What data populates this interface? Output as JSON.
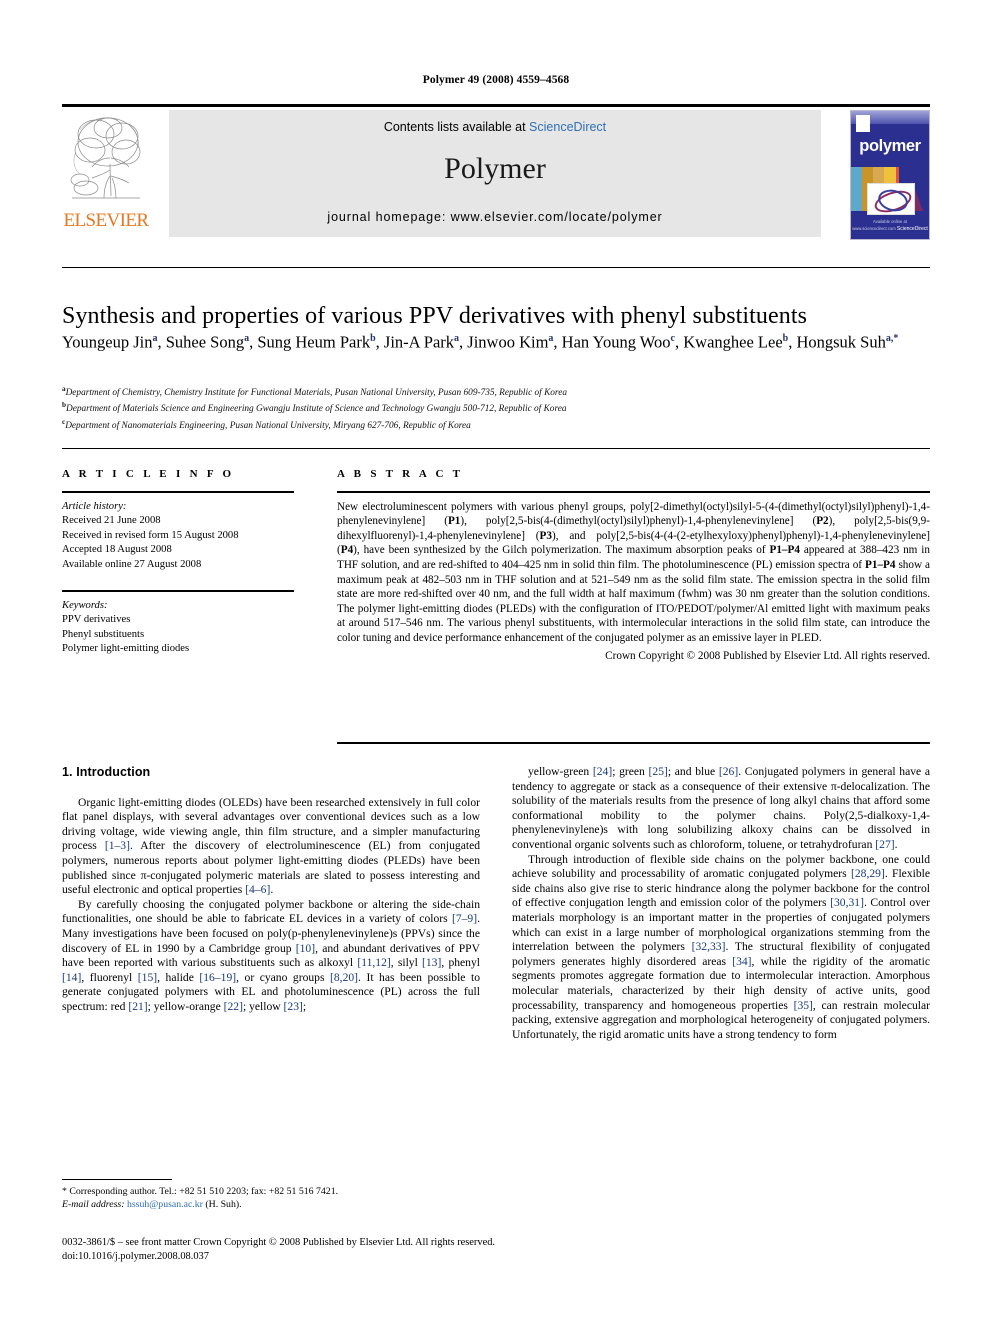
{
  "running_head": "Polymer 49 (2008) 4559–4568",
  "masthead": {
    "contents_prefix": "Contents lists available at ",
    "sciencedirect": "ScienceDirect",
    "journal_name": "Polymer",
    "homepage": "journal homepage: www.elsevier.com/locate/polymer",
    "publisher_logo_text": "ELSEVIER",
    "publisher_logo_icon": "elsevier-tree-icon",
    "cover": {
      "title": "polymer",
      "footer_line1": "Available online at www.sciencedirect.com",
      "footer_line2": "ScienceDirect"
    },
    "accent_link_color": "#2f6fb5",
    "elsevier_orange": "#E87722",
    "cover_blue": "#2b2f8f"
  },
  "article": {
    "title": "Synthesis and properties of various PPV derivatives with phenyl substituents",
    "authors": [
      {
        "name": "Youngeup Jin",
        "sup": "a",
        "sep": ", "
      },
      {
        "name": "Suhee Song",
        "sup": "a",
        "sep": ", "
      },
      {
        "name": "Sung Heum Park",
        "sup": "b",
        "sep": ", "
      },
      {
        "name": "Jin-A Park",
        "sup": "a",
        "sep": ", "
      },
      {
        "name": "Jinwoo Kim",
        "sup": "a",
        "sep": ", "
      },
      {
        "name": "Han Young Woo",
        "sup": "c",
        "sep": ", "
      },
      {
        "name": "Kwanghee Lee",
        "sup": "b",
        "sep": ", "
      },
      {
        "name": "Hongsuk Suh",
        "sup": "a,*",
        "sep": ""
      }
    ],
    "affiliations": [
      {
        "mark": "a",
        "text": "Department of Chemistry, Chemistry Institute for Functional Materials, Pusan National University, Pusan 609-735, Republic of Korea"
      },
      {
        "mark": "b",
        "text": "Department of Materials Science and Engineering Gwangju Institute of Science and Technology Gwangju 500-712, Republic of Korea"
      },
      {
        "mark": "c",
        "text": "Department of Nanomaterials Engineering, Pusan National University, Miryang 627-706, Republic of Korea"
      }
    ]
  },
  "article_info": {
    "heading": "A R T I C L E  I N F O",
    "history_title": "Article history:",
    "history": [
      "Received 21 June 2008",
      "Received in revised form 15 August 2008",
      "Accepted 18 August 2008",
      "Available online 27 August 2008"
    ],
    "keywords_title": "Keywords:",
    "keywords": [
      "PPV derivatives",
      "Phenyl substituents",
      "Polymer light-emitting diodes"
    ]
  },
  "abstract": {
    "heading": "A B S T R A C T",
    "paragraphs": [
      "New electroluminescent polymers with various phenyl groups, poly[2-dimethyl(octyl)silyl-5-(4-(dimethyl(octyl)silyl)phenyl)-1,4-phenylenevinylene] (P1), poly[2,5-bis(4-(dimethyl(octyl)silyl)phenyl)-1,4-phenylenevinylene] (P2), poly[2,5-bis(9,9-dihexylfluorenyl)-1,4-phenylenevinylene] (P3), and poly[2,5-bis(4-(4-(2-etylhexyloxy)phenyl)phenyl)-1,4-phenylenevinylene] (P4), have been synthesized by the Gilch polymerization. The maximum absorption peaks of P1–P4 appeared at 388–423 nm in THF solution, and are red-shifted to 404–425 nm in solid thin film. The photoluminescence (PL) emission spectra of P1–P4 show a maximum peak at 482–503 nm in THF solution and at 521–549 nm as the solid film state. The emission spectra in the solid film state are more red-shifted over 40 nm, and the full width at half maximum (fwhm) was 30 nm greater than the solution conditions. The polymer light-emitting diodes (PLEDs) with the configuration of ITO/PEDOT/polymer/Al emitted light with maximum peaks at around 517–546 nm. The various phenyl substituents, with intermolecular interactions in the solid film state, can introduce the color tuning and device performance enhancement of the conjugated polymer as an emissive layer in PLED."
    ],
    "copyright": "Crown Copyright © 2008 Published by Elsevier Ltd. All rights reserved."
  },
  "introduction": {
    "heading": "1.  Introduction",
    "left_paragraphs": [
      "Organic light-emitting diodes (OLEDs) have been researched extensively in full color flat panel displays, with several advantages over conventional devices such as a low driving voltage, wide viewing angle, thin film structure, and a simpler manufacturing process [1–3]. After the discovery of electroluminescence (EL) from conjugated polymers, numerous reports about polymer light-emitting diodes (PLEDs) have been published since π-conjugated polymeric materials are slated to possess interesting and useful electronic and optical properties [4–6].",
      "By carefully choosing the conjugated polymer backbone or altering the side-chain functionalities, one should be able to fabricate EL devices in a variety of colors [7–9]. Many investigations have been focused on poly(p-phenylenevinylene)s (PPVs) since the discovery of EL in 1990 by a Cambridge group [10], and abundant derivatives of PPV have been reported with various substituents such as alkoxyl [11,12], silyl [13], phenyl [14], fluorenyl [15], halide [16–19], or cyano groups [8,20]. It has been possible to generate conjugated polymers with EL and photoluminescence (PL) across the full spectrum: red [21]; yellow-orange [22]; yellow [23];"
    ],
    "right_paragraphs": [
      "yellow-green [24]; green [25]; and blue [26]. Conjugated polymers in general have a tendency to aggregate or stack as a consequence of their extensive π-delocalization. The solubility of the materials results from the presence of long alkyl chains that afford some conformational mobility to the polymer chains. Poly(2,5-dialkoxy-1,4-phenylenevinylene)s with long solubilizing alkoxy chains can be dissolved in conventional organic solvents such as chloroform, toluene, or tetrahydrofuran [27].",
      "Through introduction of flexible side chains on the polymer backbone, one could achieve solubility and processability of aromatic conjugated polymers [28,29]. Flexible side chains also give rise to steric hindrance along the polymer backbone for the control of effective conjugation length and emission color of the polymers [30,31]. Control over materials morphology is an important matter in the properties of conjugated polymers which can exist in a large number of morphological organizations stemming from the interrelation between the polymers [32,33]. The structural flexibility of conjugated polymers generates highly disordered areas [34], while the rigidity of the aromatic segments promotes aggregate formation due to intermolecular interaction. Amorphous molecular materials, characterized by their high density of active units, good processability, transparency and homogeneous properties [35], can restrain molecular packing, extensive aggregation and morphological heterogeneity of conjugated polymers. Unfortunately, the rigid aromatic units have a strong tendency to form"
    ]
  },
  "footnote": {
    "corresponding": "* Corresponding author. Tel.: +82 51 510 2203; fax: +82 51 516 7421.",
    "email_label": "E-mail address:",
    "email": "hssuh@pusan.ac.kr",
    "email_suffix": "(H. Suh)."
  },
  "footer": {
    "line1": "0032-3861/$ – see front matter Crown Copyright © 2008 Published by Elsevier Ltd. All rights reserved.",
    "doi": "doi:10.1016/j.polymer.2008.08.037"
  }
}
